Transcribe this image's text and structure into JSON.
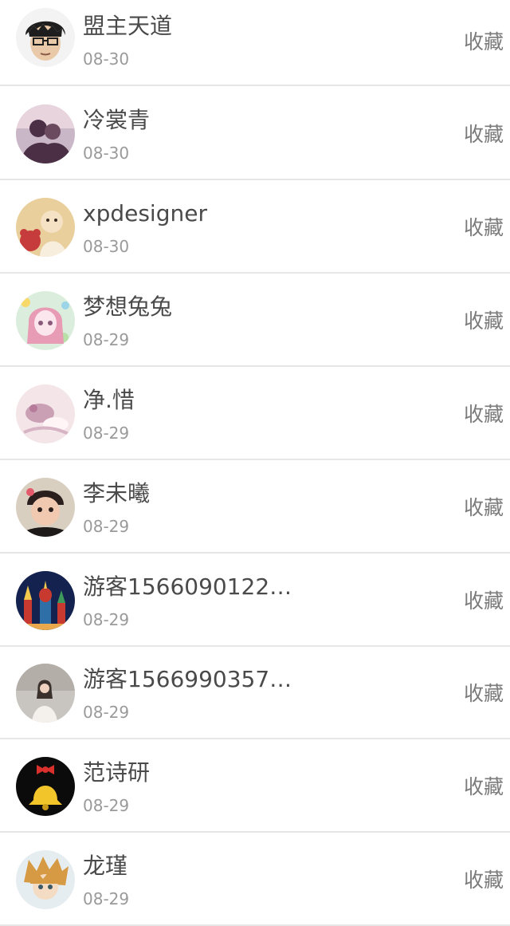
{
  "items": [
    {
      "name": "盟主天道",
      "date": "08-30",
      "action": "收藏",
      "avatar": {
        "icon": "avatar-anime-boy-glasses-icon",
        "bg": "#f3f3f3",
        "fg": "#1e1e1e",
        "accent": "#e9c9a8"
      }
    },
    {
      "name": "冷裳青",
      "date": "08-30",
      "action": "收藏",
      "avatar": {
        "icon": "avatar-couple-photo-icon",
        "bg": "#c9b7c7",
        "fg": "#4a2f45",
        "accent": "#e8d4dd"
      }
    },
    {
      "name": "xpdesigner",
      "date": "08-30",
      "action": "收藏",
      "avatar": {
        "icon": "avatar-baby-teddy-icon",
        "bg": "#e9cf9c",
        "fg": "#c63b3b",
        "accent": "#f5e2c4"
      }
    },
    {
      "name": "梦想兔兔",
      "date": "08-29",
      "action": "收藏",
      "avatar": {
        "icon": "avatar-anime-girl-icon",
        "bg": "#dbeedd",
        "fg": "#e89bb4",
        "accent": "#fce6ee"
      }
    },
    {
      "name": "净.惜",
      "date": "08-29",
      "action": "收藏",
      "avatar": {
        "icon": "avatar-pastel-drawing-icon",
        "bg": "#f4e6e8",
        "fg": "#caa0b5",
        "accent": "#fff4f6"
      }
    },
    {
      "name": "李未曦",
      "date": "08-29",
      "action": "收藏",
      "avatar": {
        "icon": "avatar-baby-photo-icon",
        "bg": "#d9cfc0",
        "fg": "#2b1f1d",
        "accent": "#f0c9b0"
      }
    },
    {
      "name": "游客1566090122…",
      "date": "08-29",
      "action": "收藏",
      "avatar": {
        "icon": "avatar-night-cathedral-icon",
        "bg": "#13224f",
        "fg": "#c8392f",
        "accent": "#f2c94c"
      }
    },
    {
      "name": "游客1566990357…",
      "date": "08-29",
      "action": "收藏",
      "avatar": {
        "icon": "avatar-girl-in-white-icon",
        "bg": "#c8c5c1",
        "fg": "#7b7470",
        "accent": "#f4f1ec"
      }
    },
    {
      "name": "范诗研",
      "date": "08-29",
      "action": "收藏",
      "avatar": {
        "icon": "avatar-bell-icon",
        "bg": "#0b0b0b",
        "fg": "#f2c52a",
        "accent": "#d9302c"
      }
    },
    {
      "name": "龙瑾",
      "date": "08-29",
      "action": "收藏",
      "avatar": {
        "icon": "avatar-anime-blond-boy-icon",
        "bg": "#e6edf0",
        "fg": "#d79a44",
        "accent": "#3b5a66"
      }
    }
  ]
}
